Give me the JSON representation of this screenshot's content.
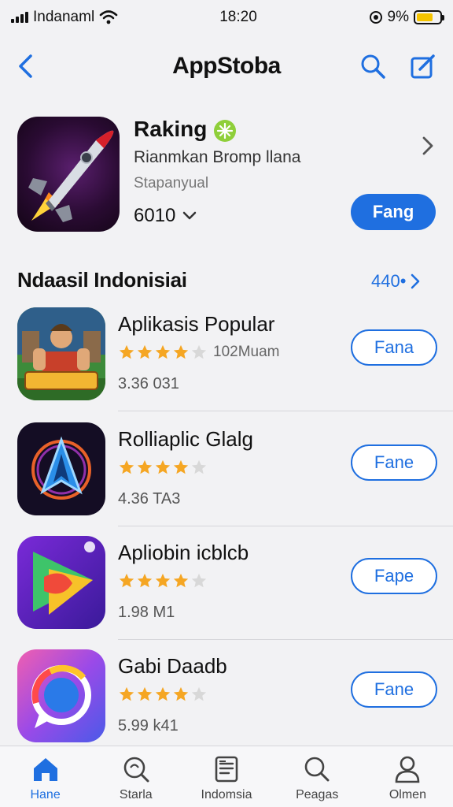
{
  "status_bar": {
    "carrier": "Indanaml",
    "time": "18:20",
    "battery": "9%"
  },
  "nav": {
    "title": "AppStoba"
  },
  "featured": {
    "title": "Raking",
    "subtitle": "Rianmkan Bromp llana",
    "developer": "Stapanyual",
    "count": "6010",
    "button": "Fang"
  },
  "section": {
    "title": "Ndaasil Indonisiai",
    "link": "440•"
  },
  "apps": [
    {
      "name": "Aplikasis Popular",
      "rating": 4,
      "reviews": "102Muam",
      "size": "3.36 031",
      "button": "Fana"
    },
    {
      "name": "Rolliaplic Glalg",
      "rating": 4,
      "reviews": "",
      "size": "4.36 TA3",
      "button": "Fane"
    },
    {
      "name": "Apliobin icblcb",
      "rating": 4,
      "reviews": "",
      "size": "1.98 M1",
      "button": "Fape"
    },
    {
      "name": "Gabi Daadb",
      "rating": 4,
      "reviews": "",
      "size": "5.99 k41",
      "button": "Fane"
    }
  ],
  "tabs": [
    {
      "label": "Hane",
      "icon": "house-icon",
      "active": true
    },
    {
      "label": "Starla",
      "icon": "search-circle-icon",
      "active": false
    },
    {
      "label": "Indomsia",
      "icon": "news-icon",
      "active": false
    },
    {
      "label": "Peagas",
      "icon": "search-icon",
      "active": false
    },
    {
      "label": "Olmen",
      "icon": "person-icon",
      "active": false
    }
  ],
  "colors": {
    "accent": "#1f6fe0",
    "star": "#f5a623",
    "background": "#f2f2f4"
  }
}
